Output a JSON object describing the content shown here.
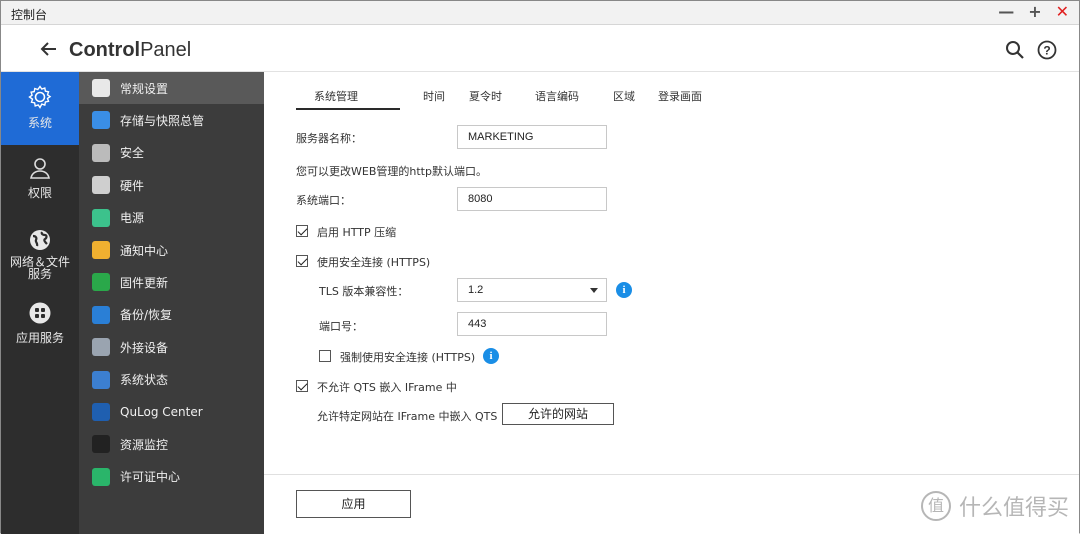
{
  "window": {
    "title": "控制台"
  },
  "header": {
    "title_bold": "Control",
    "title_rest": "Panel"
  },
  "categories": [
    {
      "label": "系统",
      "icon": "gear-icon"
    },
    {
      "label": "权限",
      "icon": "user-icon"
    },
    {
      "label": "网络＆文件服务",
      "line1": "网络＆文件",
      "line2": "服务",
      "icon": "globe-icon"
    },
    {
      "label": "应用服务",
      "icon": "apps-icon"
    }
  ],
  "nav": [
    {
      "label": "常规设置",
      "icon": "general-settings-icon",
      "color": "#e8e8e8"
    },
    {
      "label": "存储与快照总管",
      "icon": "storage-icon",
      "color": "#3a8ee6"
    },
    {
      "label": "安全",
      "icon": "lock-icon",
      "color": "#bbbbbb"
    },
    {
      "label": "硬件",
      "icon": "hardware-icon",
      "color": "#cfcfcf"
    },
    {
      "label": "电源",
      "icon": "power-icon",
      "color": "#3cc28c"
    },
    {
      "label": "通知中心",
      "icon": "notification-icon",
      "color": "#f0b030"
    },
    {
      "label": "固件更新",
      "icon": "firmware-icon",
      "color": "#2aa84a"
    },
    {
      "label": "备份/恢复",
      "icon": "backup-icon",
      "color": "#2a7fd6"
    },
    {
      "label": "外接设备",
      "icon": "external-device-icon",
      "color": "#9aa4b0"
    },
    {
      "label": "系统状态",
      "icon": "system-status-icon",
      "color": "#3c7fd0"
    },
    {
      "label": "QuLog Center",
      "icon": "qulog-icon",
      "color": "#1f5fb0"
    },
    {
      "label": "资源监控",
      "icon": "resource-monitor-icon",
      "color": "#222222"
    },
    {
      "label": "许可证中心",
      "icon": "license-icon",
      "color": "#2ab56a"
    }
  ],
  "tabs": [
    "系统管理",
    "时间",
    "夏令时",
    "语言编码",
    "区域",
    "登录画面"
  ],
  "form": {
    "server_name_label": "服务器名称：",
    "server_name_value": "MARKETING",
    "hint": "您可以更改WEB管理的http默认端口。",
    "port_label": "系统端口：",
    "port_value": "8080",
    "http_compress_label": "启用 HTTP 压缩",
    "https_label": "使用安全连接 (HTTPS)",
    "tls_label": "TLS 版本兼容性：",
    "tls_value": "1.2",
    "https_port_label": "端口号：",
    "https_port_value": "443",
    "force_https_label": "强制使用安全连接 (HTTPS)",
    "no_iframe_label": "不允许 QTS 嵌入 IFrame 中",
    "allow_sites_label": "允许特定网站在 IFrame 中嵌入 QTS",
    "allow_sites_button": "允许的网站",
    "apply_button": "应用"
  },
  "watermark": {
    "glyph": "值",
    "text": "什么值得买"
  }
}
